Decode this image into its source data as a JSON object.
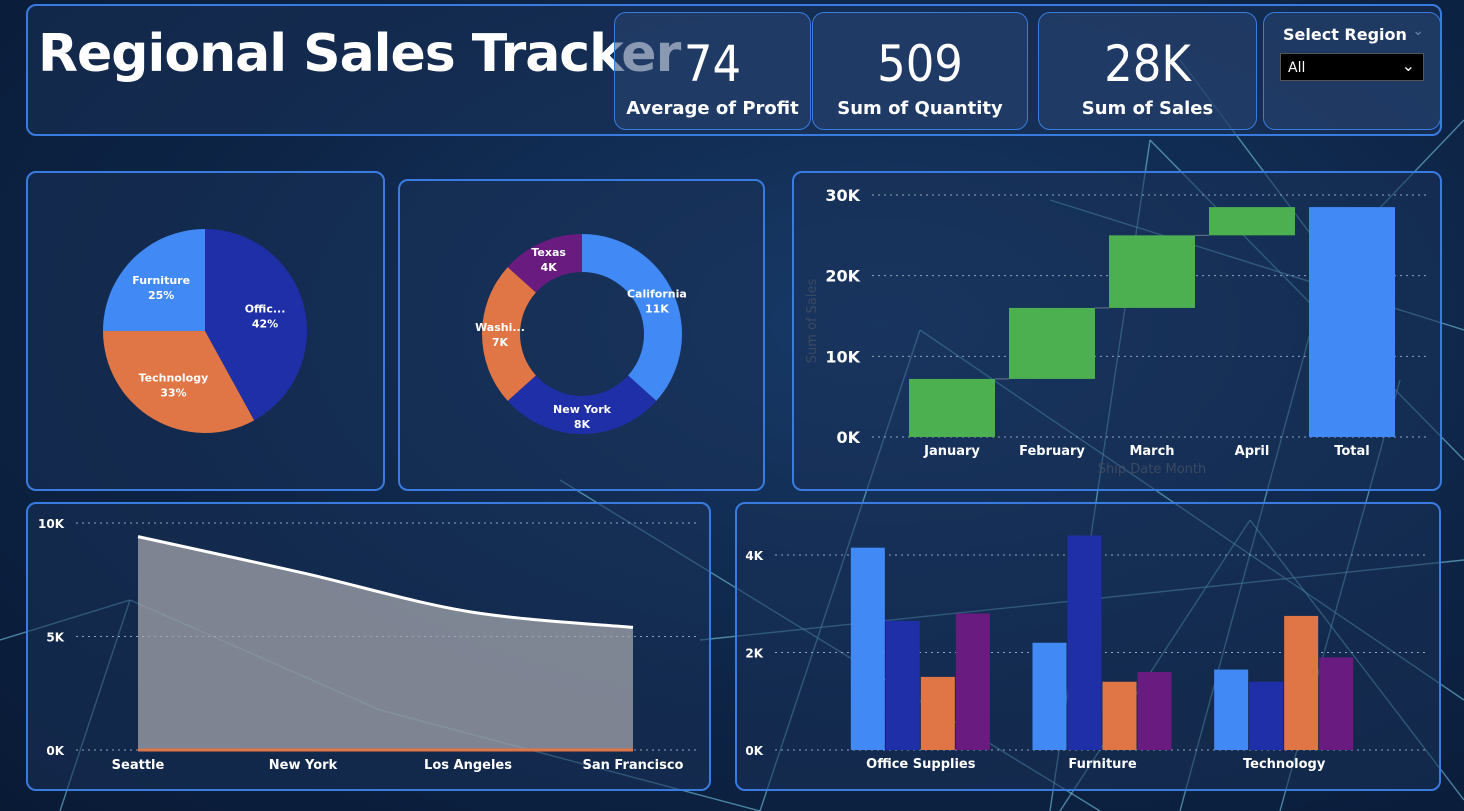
{
  "dashboard": {
    "title": "Regional Sales Tracker"
  },
  "kpis": [
    {
      "value": "74",
      "label": "Average of Profit"
    },
    {
      "value": "509",
      "label": "Sum of Quantity"
    },
    {
      "value": "28K",
      "label": "Sum of Sales"
    }
  ],
  "slicer": {
    "label": "Select Region",
    "selected": "All"
  },
  "chart_data": [
    {
      "type": "pie",
      "labels": [
        "Office Supplies",
        "Furniture",
        "Technology"
      ],
      "display_labels": [
        "Offic...",
        "Furniture",
        "Technology"
      ],
      "values": [
        42,
        25,
        33
      ],
      "value_labels": [
        "42%",
        "25%",
        "33%"
      ],
      "colors": [
        "#1f2fa8",
        "#4189f5",
        "#e07545"
      ]
    },
    {
      "type": "pie",
      "donut": true,
      "labels": [
        "California",
        "New York",
        "Washington",
        "Texas"
      ],
      "display_labels": [
        "California",
        "New York",
        "Washi...",
        "Texas"
      ],
      "values": [
        11,
        8,
        7,
        4
      ],
      "value_labels": [
        "11K",
        "8K",
        "7K",
        "4K"
      ],
      "colors": [
        "#4189f5",
        "#1f2fa8",
        "#e07545",
        "#6a1b80"
      ]
    },
    {
      "type": "bar",
      "subtype": "waterfall",
      "categories": [
        "January",
        "February",
        "March",
        "April",
        "Total"
      ],
      "values": [
        7200,
        8800,
        9000,
        3500,
        28500
      ],
      "ylabel": "Sum of Sales",
      "xlabel": "Ship Date Month",
      "ylim": [
        0,
        30000
      ],
      "yticks": [
        "0K",
        "10K",
        "20K",
        "30K"
      ],
      "colors": {
        "increase": "#4caf50",
        "total": "#4189f5"
      }
    },
    {
      "type": "area",
      "categories": [
        "Seattle",
        "New York",
        "Los Angeles",
        "San Francisco"
      ],
      "series": [
        {
          "values": [
            9400,
            7800,
            6100,
            5400
          ],
          "color": "#ffffff"
        },
        {
          "values": [
            0,
            0,
            0,
            0
          ],
          "color": "#e07545"
        }
      ],
      "ylim": [
        0,
        10000
      ],
      "yticks": [
        "0K",
        "5K",
        "10K"
      ]
    },
    {
      "type": "bar",
      "categories": [
        "Office Supplies",
        "Furniture",
        "Technology"
      ],
      "series": [
        {
          "values": [
            4150,
            2200,
            1650
          ],
          "color": "#4189f5"
        },
        {
          "values": [
            2650,
            4400,
            1400
          ],
          "color": "#1f2fa8"
        },
        {
          "values": [
            1500,
            1400,
            2750
          ],
          "color": "#e07545"
        },
        {
          "values": [
            2800,
            1600,
            1900
          ],
          "color": "#6a1b80"
        }
      ],
      "ylim": [
        0,
        4800
      ],
      "yticks": [
        "0K",
        "2K",
        "4K"
      ]
    }
  ]
}
